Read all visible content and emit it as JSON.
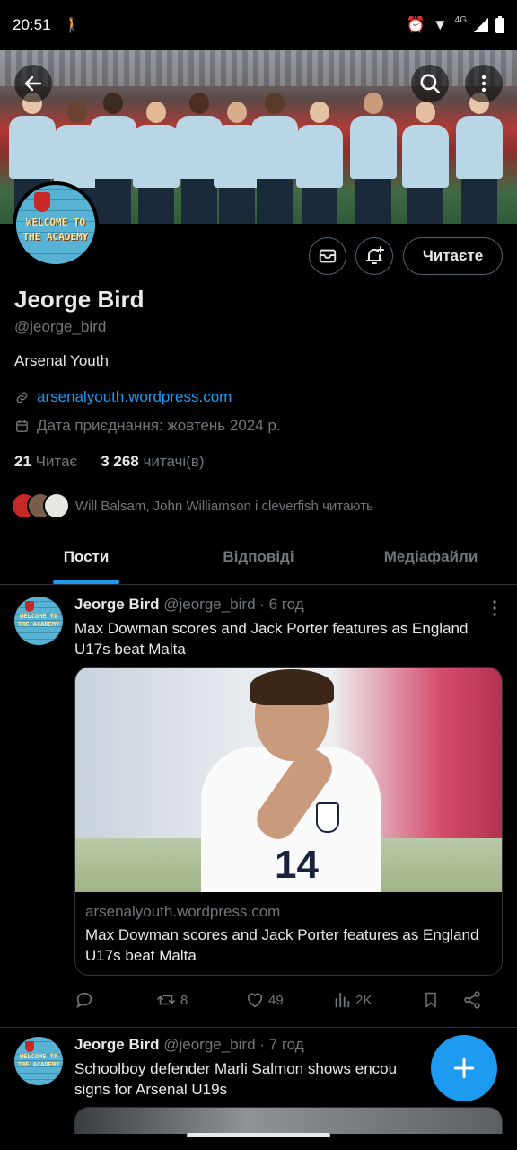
{
  "status": {
    "time": "20:51",
    "network": "4G"
  },
  "profile": {
    "name": "Jeorge Bird",
    "handle": "@jeorge_bird",
    "bio": "Arsenal Youth",
    "link": "arsenalyouth.wordpress.com",
    "joined": "Дата приєднання: жовтень 2024 р.",
    "following_count": "21",
    "following_label": "Читає",
    "followers_count": "3 268",
    "followers_label": "читачі(в)",
    "followed_by": "Will Balsam, John Williamson і cleverfish читають",
    "avatar_text": "WELCOME TO THE ACADEMY",
    "follow_button": "Читаєте"
  },
  "tabs": [
    {
      "label": "Пости",
      "active": true
    },
    {
      "label": "Відповіді",
      "active": false
    },
    {
      "label": "Медіафайли",
      "active": false
    }
  ],
  "posts": [
    {
      "author": "Jeorge Bird",
      "handle": "@jeorge_bird",
      "time": "· 6 год",
      "text": "Max Dowman scores and Jack Porter features as England U17s beat Malta",
      "card": {
        "domain": "arsenalyouth.wordpress.com",
        "title": "Max Dowman scores and Jack Porter features as England U17s beat Malta",
        "shirt_number": "14"
      },
      "replies": "",
      "reposts": "8",
      "likes": "49",
      "views": "2K"
    },
    {
      "author": "Jeorge Bird",
      "handle": "@jeorge_bird",
      "time": "· 7 год",
      "text_line1": "Schoolboy defender Marli Salmon shows encou",
      "text_line2": "signs for Arsenal U19s"
    }
  ],
  "colors": {
    "accent": "#1d9bf0",
    "background": "#000000",
    "muted": "#71767b",
    "text": "#e7e9ea"
  },
  "icons": [
    "back-arrow-icon",
    "search-icon",
    "more-vertical-icon",
    "mail-icon",
    "bell-plus-icon",
    "link-icon",
    "calendar-icon",
    "reply-icon",
    "repost-icon",
    "heart-icon",
    "views-icon",
    "bookmark-icon",
    "share-icon",
    "plus-icon"
  ]
}
